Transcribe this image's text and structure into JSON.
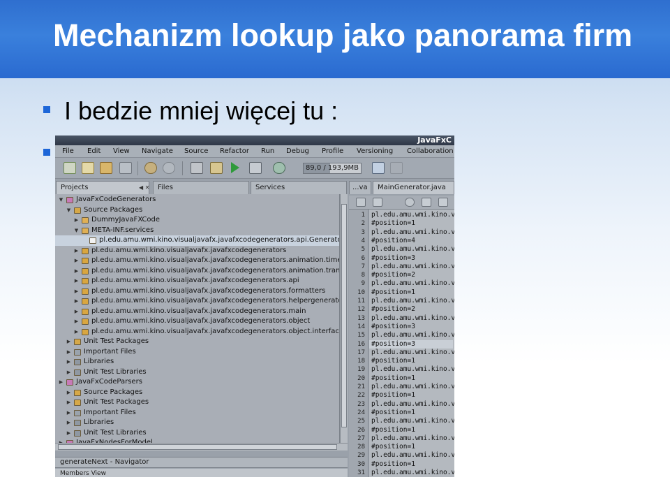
{
  "slide": {
    "title": "Mechanizm lookup jako panorama firm",
    "bullet": "I bedzie mniej więcej tu :"
  },
  "colors": {
    "title_bar": "#2f6fcf",
    "bullet": "#1d66d8",
    "ide_background": "#9aa1aa"
  },
  "ide": {
    "window_title": "JavaFxC",
    "menu": [
      "File",
      "Edit",
      "View",
      "Navigate",
      "Source",
      "Refactor",
      "Run",
      "Debug",
      "Profile",
      "Versioning",
      "Collaboration"
    ],
    "memory": {
      "label": "89,0 / 193,9MB",
      "used_fraction": 0.46
    },
    "tabs": {
      "projects": "Projects",
      "files": "Files",
      "services": "Services",
      "editor_prev": "...va",
      "editor_active": "MainGenerator.java"
    },
    "tree": [
      {
        "label": "JavaFxCodeGenerators",
        "icon": "project-icon"
      },
      {
        "label": "Source Packages",
        "icon": "package-folder-icon"
      },
      {
        "label": "DummyJavaFXCode",
        "icon": "folder-icon"
      },
      {
        "label": "META-INF.services",
        "icon": "folder-icon"
      },
      {
        "label": "pl.edu.amu.wmi.kino.visualjavafx.javafxcodegenerators.api.Generato",
        "icon": "file-icon"
      },
      {
        "label": "pl.edu.amu.wmi.kino.visualjavafx.javafxcodegenerators",
        "icon": "package-icon"
      },
      {
        "label": "pl.edu.amu.wmi.kino.visualjavafx.javafxcodegenerators.animation.time",
        "icon": "package-icon"
      },
      {
        "label": "pl.edu.amu.wmi.kino.visualjavafx.javafxcodegenerators.animation.tran",
        "icon": "package-icon"
      },
      {
        "label": "pl.edu.amu.wmi.kino.visualjavafx.javafxcodegenerators.api",
        "icon": "package-icon"
      },
      {
        "label": "pl.edu.amu.wmi.kino.visualjavafx.javafxcodegenerators.formatters",
        "icon": "package-icon"
      },
      {
        "label": "pl.edu.amu.wmi.kino.visualjavafx.javafxcodegenerators.helpergenerato",
        "icon": "package-icon"
      },
      {
        "label": "pl.edu.amu.wmi.kino.visualjavafx.javafxcodegenerators.main",
        "icon": "package-icon"
      },
      {
        "label": "pl.edu.amu.wmi.kino.visualjavafx.javafxcodegenerators.object",
        "icon": "package-icon"
      },
      {
        "label": "pl.edu.amu.wmi.kino.visualjavafx.javafxcodegenerators.object.interface",
        "icon": "package-icon"
      },
      {
        "label": "Unit Test Packages",
        "icon": "package-folder-icon"
      },
      {
        "label": "Important Files",
        "icon": "important-files-icon"
      },
      {
        "label": "Libraries",
        "icon": "library-icon"
      },
      {
        "label": "Unit Test Libraries",
        "icon": "library-icon"
      },
      {
        "label": "JavaFxCodeParsers",
        "icon": "project-icon"
      },
      {
        "label": "Source Packages",
        "icon": "package-folder-icon"
      },
      {
        "label": "Unit Test Packages",
        "icon": "package-folder-icon"
      },
      {
        "label": "Important Files",
        "icon": "important-files-icon"
      },
      {
        "label": "Libraries",
        "icon": "library-icon"
      },
      {
        "label": "Unit Test Libraries",
        "icon": "library-icon"
      },
      {
        "label": "JavaFxNodesForModel",
        "icon": "project-icon"
      }
    ],
    "navigator_title": "generateNext - Navigator",
    "members_view": "Members View",
    "code_lines": [
      "pl.edu.amu.wmi.kino.v",
      "#position=1",
      "pl.edu.amu.wmi.kino.v",
      "#position=4",
      "pl.edu.amu.wmi.kino.v",
      "#position=3",
      "pl.edu.amu.wmi.kino.v",
      "#position=2",
      "pl.edu.amu.wmi.kino.v",
      "#position=1",
      "pl.edu.amu.wmi.kino.v",
      "#position=2",
      "pl.edu.amu.wmi.kino.v",
      "#position=3",
      "pl.edu.amu.wmi.kino.v",
      "#position=3",
      "pl.edu.amu.wmi.kino.v",
      "#position=1",
      "pl.edu.amu.wmi.kino.v",
      "#position=1",
      "pl.edu.amu.wmi.kino.v",
      "#position=1",
      "pl.edu.amu.wmi.kino.v",
      "#position=1",
      "pl.edu.amu.wmi.kino.v",
      "#position=1",
      "pl.edu.amu.wmi.kino.v",
      "#position=1",
      "pl.edu.amu.wmi.kino.v",
      "#position=1",
      "pl.edu.amu.wmi.kino.v"
    ],
    "line_numbers": [
      "1",
      "2",
      "3",
      "4",
      "5",
      "6",
      "7",
      "8",
      "9",
      "10",
      "11",
      "12",
      "13",
      "14",
      "15",
      "16",
      "17",
      "18",
      "19",
      "20",
      "21",
      "22",
      "23",
      "24",
      "25",
      "26",
      "27",
      "28",
      "29",
      "30",
      "31"
    ],
    "current_line": 16
  }
}
